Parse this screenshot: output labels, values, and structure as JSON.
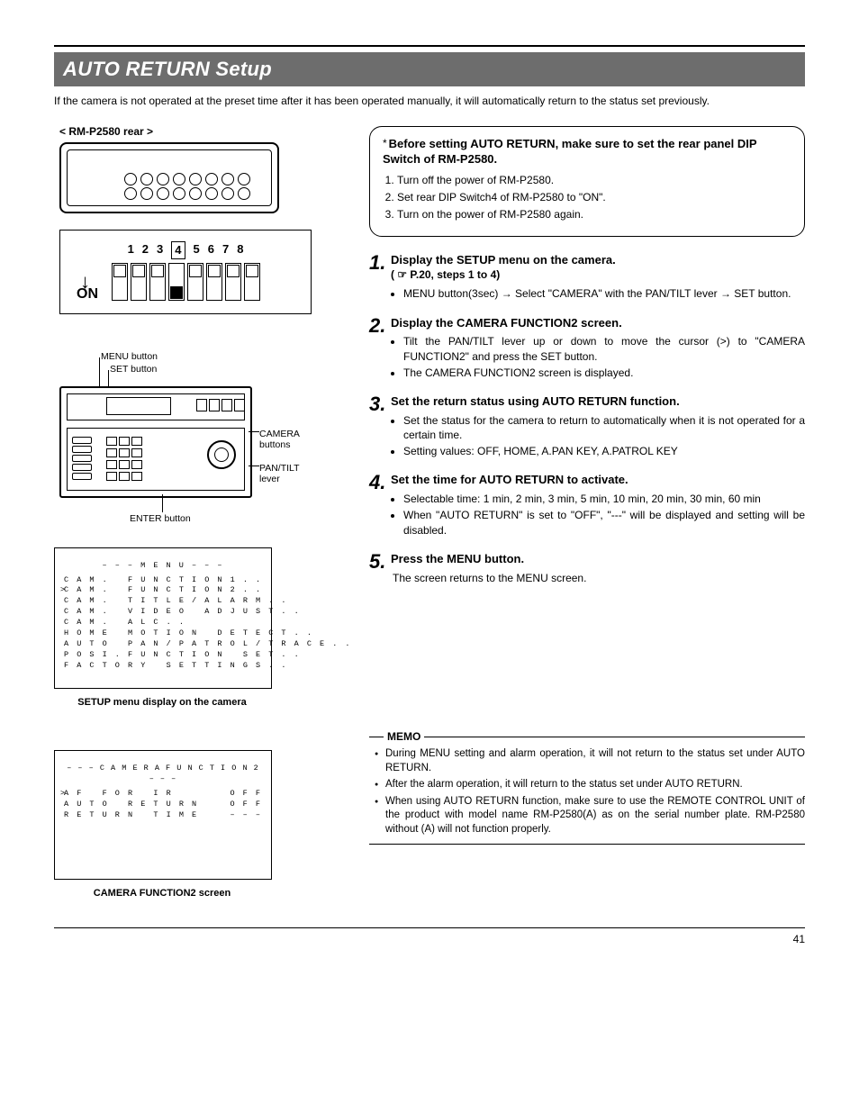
{
  "header": {
    "title": "AUTO RETURN Setup"
  },
  "intro": "If the camera is not operated at the preset time after it has been operated manually, it will automatically return to the status set previously.",
  "left": {
    "rear_label": "< RM-P2580 rear >",
    "dip": {
      "nums": [
        "1",
        "2",
        "3",
        "4",
        "5",
        "6",
        "7",
        "8"
      ],
      "on": "ON"
    },
    "controller": {
      "menu": "MENU button",
      "set": "SET button",
      "camera": "CAMERA",
      "buttons": "buttons",
      "pan": "PAN/TILT",
      "lever": "lever",
      "enter": "ENTER button"
    },
    "osd1": {
      "title": "– – – M E N U – – –",
      "rows": [
        "C A M .   F U N C T I O N 1 . .",
        "C A M .   F U N C T I O N 2 . .",
        "C A M .   T I T L E / A L A R M . .",
        "C A M .   V I D E O   A D J U S T . .",
        "C A M .   A L C . .",
        "H O M E   M O T I O N   D E T E C T . .",
        "A U T O   P A N / P A T R O L / T R A C E . .",
        "P O S I . F U N C T I O N   S E T . .",
        "F A C T O R Y   S E T T I N G S . ."
      ],
      "caption": "SETUP menu display on the camera"
    },
    "osd2": {
      "title": "– – – C A M E R A   F U N C T I O N 2 – – –",
      "rows": [
        {
          "l": "A F   F O R   I R",
          "r": "O F F"
        },
        {
          "l": "A U T O   R E T U R N",
          "r": "O F F"
        },
        {
          "l": "R E T U R N   T I M E",
          "r": "– – –"
        }
      ],
      "caption": "CAMERA FUNCTION2 screen"
    }
  },
  "info": {
    "heading": "Before setting AUTO RETURN, make sure to set the rear panel DIP Switch of RM-P2580.",
    "items": [
      "Turn off the power of RM-P2580.",
      "Set rear DIP Switch4 of RM-P2580 to \"ON\".",
      "Turn on the power of RM-P2580 again."
    ]
  },
  "steps": [
    {
      "num": "1.",
      "title_a": "Display the SETUP menu on the camera.",
      "title_b": "( ☞ P.20, steps 1 to 4)",
      "bullets": [
        "MENU button(3sec) → Select \"CAMERA\" with the PAN/TILT lever → SET button."
      ]
    },
    {
      "num": "2.",
      "title_a": "Display the CAMERA FUNCTION2 screen.",
      "bullets": [
        "Tilt the PAN/TILT lever up or down to move the cursor (>) to \"CAMERA FUNCTION2\" and press the SET button.",
        "The CAMERA FUNCTION2 screen is displayed."
      ]
    },
    {
      "num": "3.",
      "title_a": "Set the return status using AUTO RETURN function.",
      "bullets": [
        "Set the status for the camera to return to automatically when it is not operated for a certain time.",
        "Setting values: OFF, HOME, A.PAN KEY, A.PATROL KEY"
      ]
    },
    {
      "num": "4.",
      "title_a": "Set the time for AUTO RETURN to activate.",
      "bullets": [
        "Selectable time: 1 min, 2 min, 3 min, 5 min, 10 min, 20 min, 30 min, 60 min",
        "When \"AUTO RETURN\" is set to \"OFF\", \"---\" will be displayed and setting will be disabled."
      ]
    },
    {
      "num": "5.",
      "title_a": "Press the MENU button.",
      "text": "The screen returns to the MENU screen."
    }
  ],
  "memo": {
    "label": "MEMO",
    "items": [
      "During MENU setting and alarm operation, it will not return to the status set under AUTO RETURN.",
      "After the alarm operation, it will return to the status set under AUTO RETURN.",
      "When using AUTO RETURN function, make sure to use the REMOTE CONTROL UNIT of the product with model name RM-P2580(A) as on the serial number plate. RM-P2580 without (A) will not function properly."
    ]
  },
  "page_number": "41"
}
